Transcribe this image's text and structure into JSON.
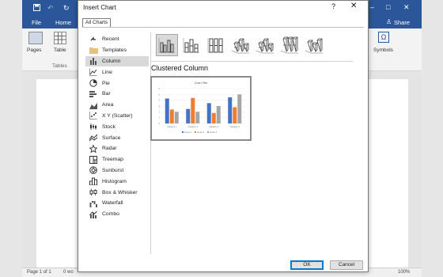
{
  "word": {
    "tabs": [
      "File",
      "Home"
    ],
    "share": "Share",
    "ribbon_labels": {
      "pages": "Pages",
      "table": "Table",
      "tables_group": "Tables",
      "symbols": "Symbols"
    },
    "status": {
      "page": "Page 1 of 1",
      "words": "0 wo",
      "zoom": "100%"
    }
  },
  "dialog": {
    "title": "Insert Chart",
    "help_glyph": "?",
    "close_glyph": "✕",
    "tab": "All Charts",
    "chart_types": [
      {
        "label": "Recent",
        "icon": "recent-icon"
      },
      {
        "label": "Templates",
        "icon": "folder-icon"
      },
      {
        "label": "Column",
        "icon": "column-chart-icon",
        "selected": true
      },
      {
        "label": "Line",
        "icon": "line-chart-icon"
      },
      {
        "label": "Pie",
        "icon": "pie-chart-icon"
      },
      {
        "label": "Bar",
        "icon": "bar-chart-icon"
      },
      {
        "label": "Area",
        "icon": "area-chart-icon"
      },
      {
        "label": "X Y (Scatter)",
        "icon": "scatter-chart-icon"
      },
      {
        "label": "Stock",
        "icon": "stock-chart-icon"
      },
      {
        "label": "Surface",
        "icon": "surface-chart-icon"
      },
      {
        "label": "Radar",
        "icon": "radar-chart-icon"
      },
      {
        "label": "Treemap",
        "icon": "treemap-chart-icon"
      },
      {
        "label": "Sunburst",
        "icon": "sunburst-chart-icon"
      },
      {
        "label": "Histogram",
        "icon": "histogram-chart-icon"
      },
      {
        "label": "Box & Whisker",
        "icon": "box-whisker-chart-icon"
      },
      {
        "label": "Waterfall",
        "icon": "waterfall-chart-icon"
      },
      {
        "label": "Combo",
        "icon": "combo-chart-icon"
      }
    ],
    "subtypes": [
      "clustered-column",
      "stacked-column",
      "100-stacked-column",
      "3d-clustered-column",
      "3d-stacked-column",
      "3d-100-stacked-column",
      "3d-column"
    ],
    "selected_subtype": 0,
    "variant_title": "Clustered Column",
    "preview": {
      "title": "Chart Title",
      "categories": [
        "Category 1",
        "Category 2",
        "Category 3",
        "Category 4"
      ],
      "series": [
        {
          "name": "Series 1",
          "values": [
            4.3,
            2.5,
            3.5,
            4.5
          ]
        },
        {
          "name": "Series 2",
          "values": [
            2.4,
            4.4,
            1.8,
            2.8
          ]
        },
        {
          "name": "Series 3",
          "values": [
            2,
            2,
            3,
            5
          ]
        }
      ],
      "colors": [
        "#4472c4",
        "#ed7d31",
        "#a5a5a5"
      ],
      "ylim": [
        0,
        6
      ]
    },
    "ok": "OK",
    "cancel": "Cancel"
  }
}
